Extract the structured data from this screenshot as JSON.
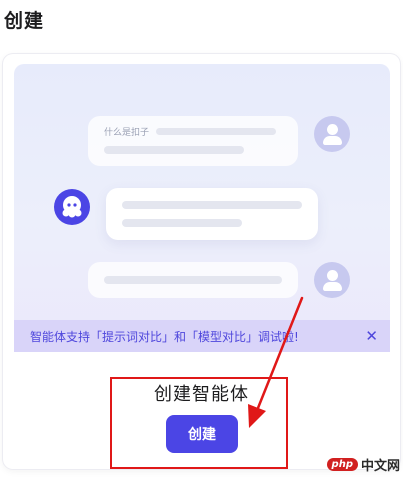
{
  "page": {
    "title": "创建"
  },
  "banner": {
    "sample_question": "什么是扣子",
    "notice_text": "智能体支持「提示词对比」和「模型对比」调试啦!",
    "close_glyph": "✕"
  },
  "create_section": {
    "heading": "创建智能体",
    "button_label": "创建"
  },
  "annotation": {
    "color": "#e01818"
  },
  "watermark": {
    "logo_text": "php",
    "site_text": "中文网"
  },
  "colors": {
    "accent": "#4b45e5",
    "notice_bg": "#d9d4f9",
    "notice_text": "#4e46dc"
  }
}
